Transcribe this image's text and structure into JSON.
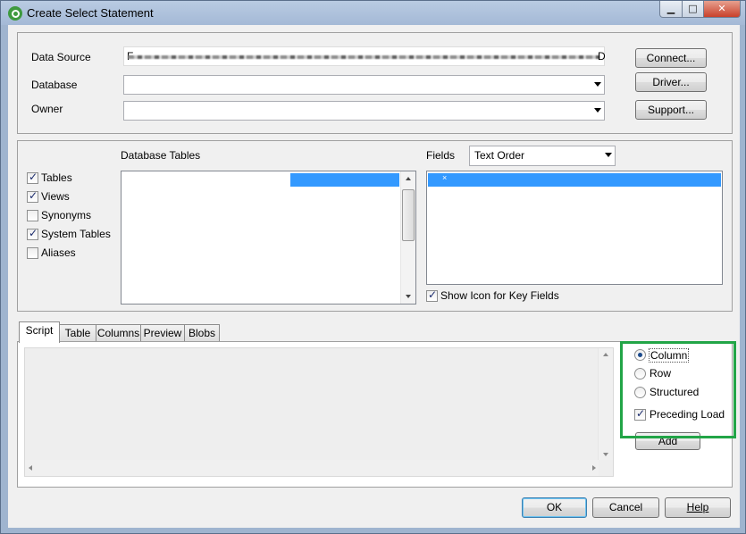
{
  "window": {
    "title": "Create Select Statement",
    "controls": {
      "minimize": "▁",
      "maximize": "□",
      "close": "✕"
    }
  },
  "connection": {
    "data_source_label": "Data Source",
    "data_source_value_end": "D",
    "data_source_prefix": "F",
    "database_label": "Database",
    "database_value": "",
    "owner_label": "Owner",
    "owner_value": "",
    "connect_button": "Connect...",
    "driver_button": "Driver...",
    "support_button": "Support..."
  },
  "tables": {
    "filter_options": [
      {
        "label": "Tables",
        "checked": true
      },
      {
        "label": "Views",
        "checked": true
      },
      {
        "label": "Synonyms",
        "checked": false
      },
      {
        "label": "System Tables",
        "checked": true
      },
      {
        "label": "Aliases",
        "checked": false
      }
    ],
    "database_tables_label": "Database Tables",
    "fields_label": "Fields",
    "fields_order_value": "Text Order",
    "fields_selected_marker": "×",
    "show_icon_label": "Show Icon for Key Fields",
    "show_icon_checked": true
  },
  "script_tabs": [
    "Script",
    "Table",
    "Columns",
    "Preview",
    "Blobs"
  ],
  "active_tab": "Script",
  "options": {
    "radios": [
      {
        "label": "Column",
        "selected": true
      },
      {
        "label": "Row",
        "selected": false
      },
      {
        "label": "Structured",
        "selected": false
      }
    ],
    "preceding_load_label": "Preceding Load",
    "preceding_load_checked": true,
    "add_button": "Add"
  },
  "footer": {
    "ok_button": "OK",
    "cancel_button": "Cancel",
    "help_button": "Help"
  },
  "colors": {
    "selection": "#3399ff",
    "highlight_box": "#22a547",
    "titlebar": "#a4b9d6"
  }
}
